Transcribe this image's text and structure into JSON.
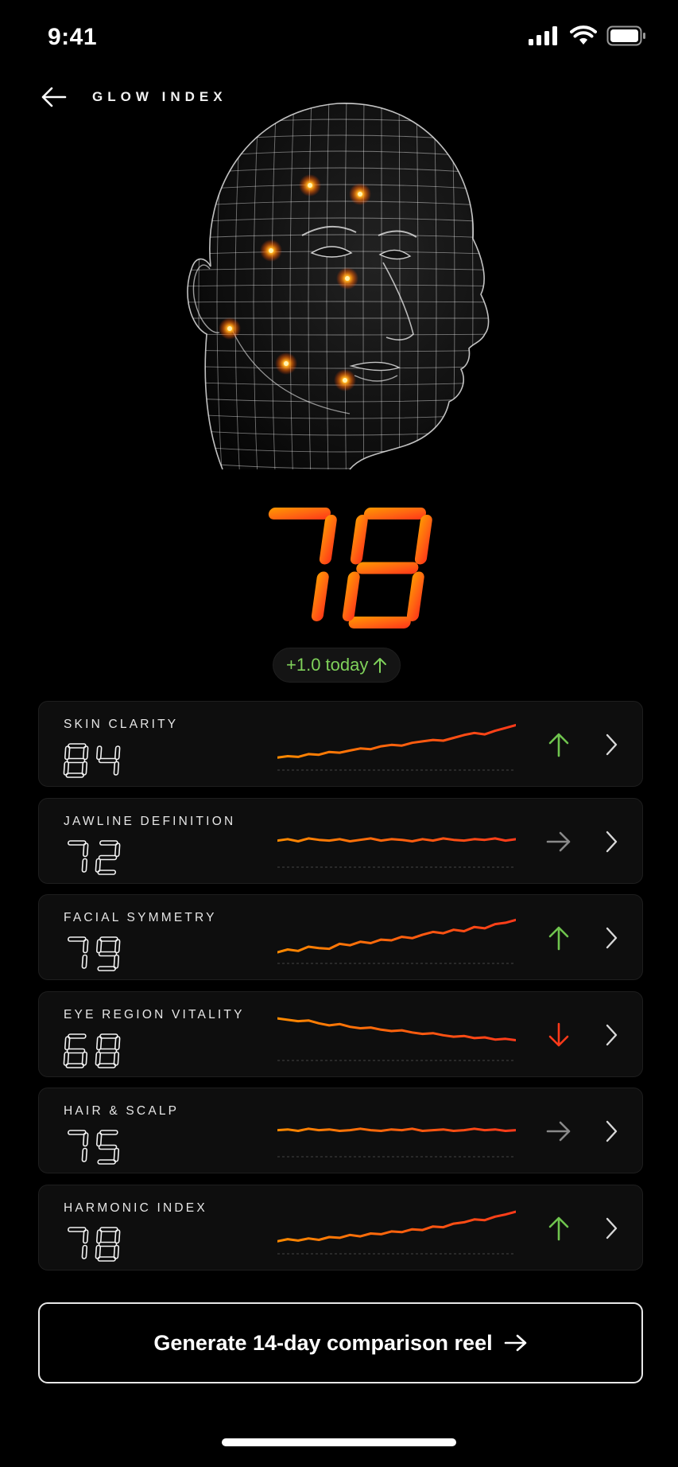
{
  "status_bar": {
    "time": "9:41"
  },
  "header": {
    "title": "GLOW INDEX"
  },
  "hero": {
    "score": "78",
    "delta": "+1.0 today",
    "delta_direction": "up"
  },
  "colors": {
    "accent_orange": "#ff8a00",
    "accent_red": "#ff3a1a",
    "trend_up": "#6fc44e",
    "trend_down": "#ff3a1a",
    "trend_flat": "#8a8a8a"
  },
  "metrics": [
    {
      "label": "SKIN CLARITY",
      "value": "84",
      "trend": "up",
      "trend_icon": "arrow-up-icon",
      "series": [
        20,
        22,
        21,
        25,
        24,
        28,
        27,
        30,
        33,
        32,
        36,
        38,
        37,
        41,
        43,
        45,
        44,
        48,
        52,
        55,
        53,
        58,
        62,
        66
      ]
    },
    {
      "label": "JAWLINE DEFINITION",
      "value": "72",
      "trend": "flat",
      "trend_icon": "arrow-right-icon",
      "series": [
        40,
        42,
        39,
        43,
        41,
        40,
        42,
        39,
        41,
        43,
        40,
        42,
        41,
        39,
        42,
        40,
        43,
        41,
        40,
        42,
        41,
        43,
        40,
        42
      ]
    },
    {
      "label": "FACIAL SYMMETRY",
      "value": "79",
      "trend": "up",
      "trend_icon": "arrow-up-icon",
      "series": [
        18,
        22,
        20,
        26,
        24,
        23,
        30,
        28,
        33,
        31,
        36,
        35,
        40,
        38,
        43,
        47,
        45,
        50,
        48,
        54,
        52,
        58,
        60,
        64
      ]
    },
    {
      "label": "EYE REGION VITALITY",
      "value": "68",
      "trend": "down",
      "trend_icon": "arrow-down-icon",
      "series": [
        62,
        60,
        58,
        59,
        55,
        52,
        54,
        50,
        48,
        49,
        46,
        44,
        45,
        42,
        40,
        41,
        38,
        36,
        37,
        34,
        35,
        32,
        33,
        31
      ]
    },
    {
      "label": "HAIR & SCALP",
      "value": "75",
      "trend": "flat",
      "trend_icon": "arrow-right-icon",
      "series": [
        40,
        41,
        39,
        42,
        40,
        41,
        39,
        40,
        42,
        40,
        39,
        41,
        40,
        42,
        39,
        40,
        41,
        39,
        40,
        42,
        40,
        41,
        39,
        40
      ]
    },
    {
      "label": "HARMONIC INDEX",
      "value": "78",
      "trend": "up",
      "trend_icon": "arrow-up-icon",
      "series": [
        20,
        23,
        21,
        24,
        22,
        26,
        25,
        29,
        27,
        31,
        30,
        34,
        33,
        37,
        36,
        41,
        40,
        45,
        47,
        51,
        50,
        55,
        58,
        62
      ]
    }
  ],
  "cta": {
    "label": "Generate 14-day comparison reel"
  }
}
